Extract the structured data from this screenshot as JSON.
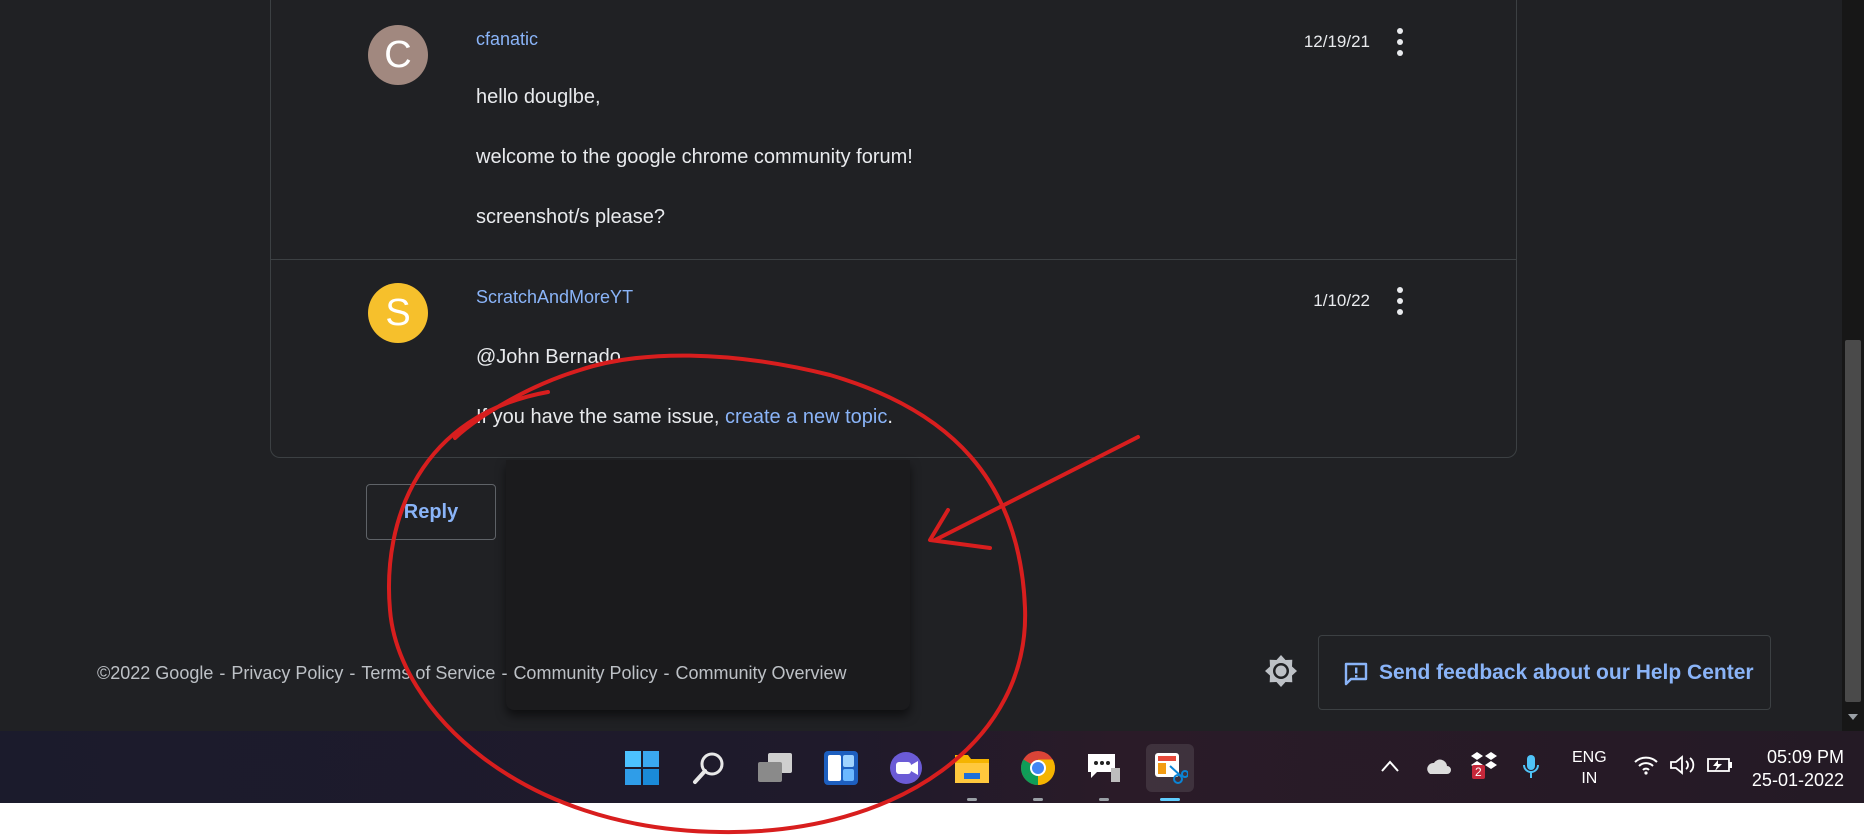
{
  "thread": {
    "posts": [
      {
        "avatar_letter": "C",
        "author": "cfanatic",
        "date": "12/19/21",
        "lines": [
          "hello douglbe,",
          "welcome to the google chrome community forum!",
          "screenshot/s please?"
        ]
      },
      {
        "avatar_letter": "S",
        "author": "ScratchAndMoreYT",
        "date": "1/10/22",
        "line1": "@John Bernado",
        "line2_prefix": "If you have the same issue, ",
        "line2_link": "create a new topic",
        "line2_suffix": "."
      }
    ],
    "reply_label": "Reply"
  },
  "footer": {
    "copyright": "©2022 Google",
    "separator": "-",
    "links": [
      "Privacy Policy",
      "Terms of Service",
      "Community Policy",
      "Community Overview"
    ]
  },
  "feedback": {
    "label": "Send feedback about our Help Center",
    "icon": "feedback-icon"
  },
  "theme_toggle": {
    "icon": "brightness-icon"
  },
  "taskbar": {
    "apps": [
      "start-icon",
      "search-icon",
      "task-view-icon",
      "widgets-icon",
      "chat-icon",
      "file-explorer-icon",
      "chrome-icon",
      "feedback-hub-icon",
      "snipping-tool-icon"
    ],
    "tray": {
      "language_line1": "ENG",
      "language_line2": "IN",
      "dropbox_badge": "2",
      "time": "05:09 PM",
      "date": "25-01-2022"
    }
  },
  "colors": {
    "page_bg": "#202124",
    "link": "#8ab4f8",
    "annotation": "#d81e1e",
    "avatar_c": "#a1887f",
    "avatar_s": "#f6c02c"
  }
}
